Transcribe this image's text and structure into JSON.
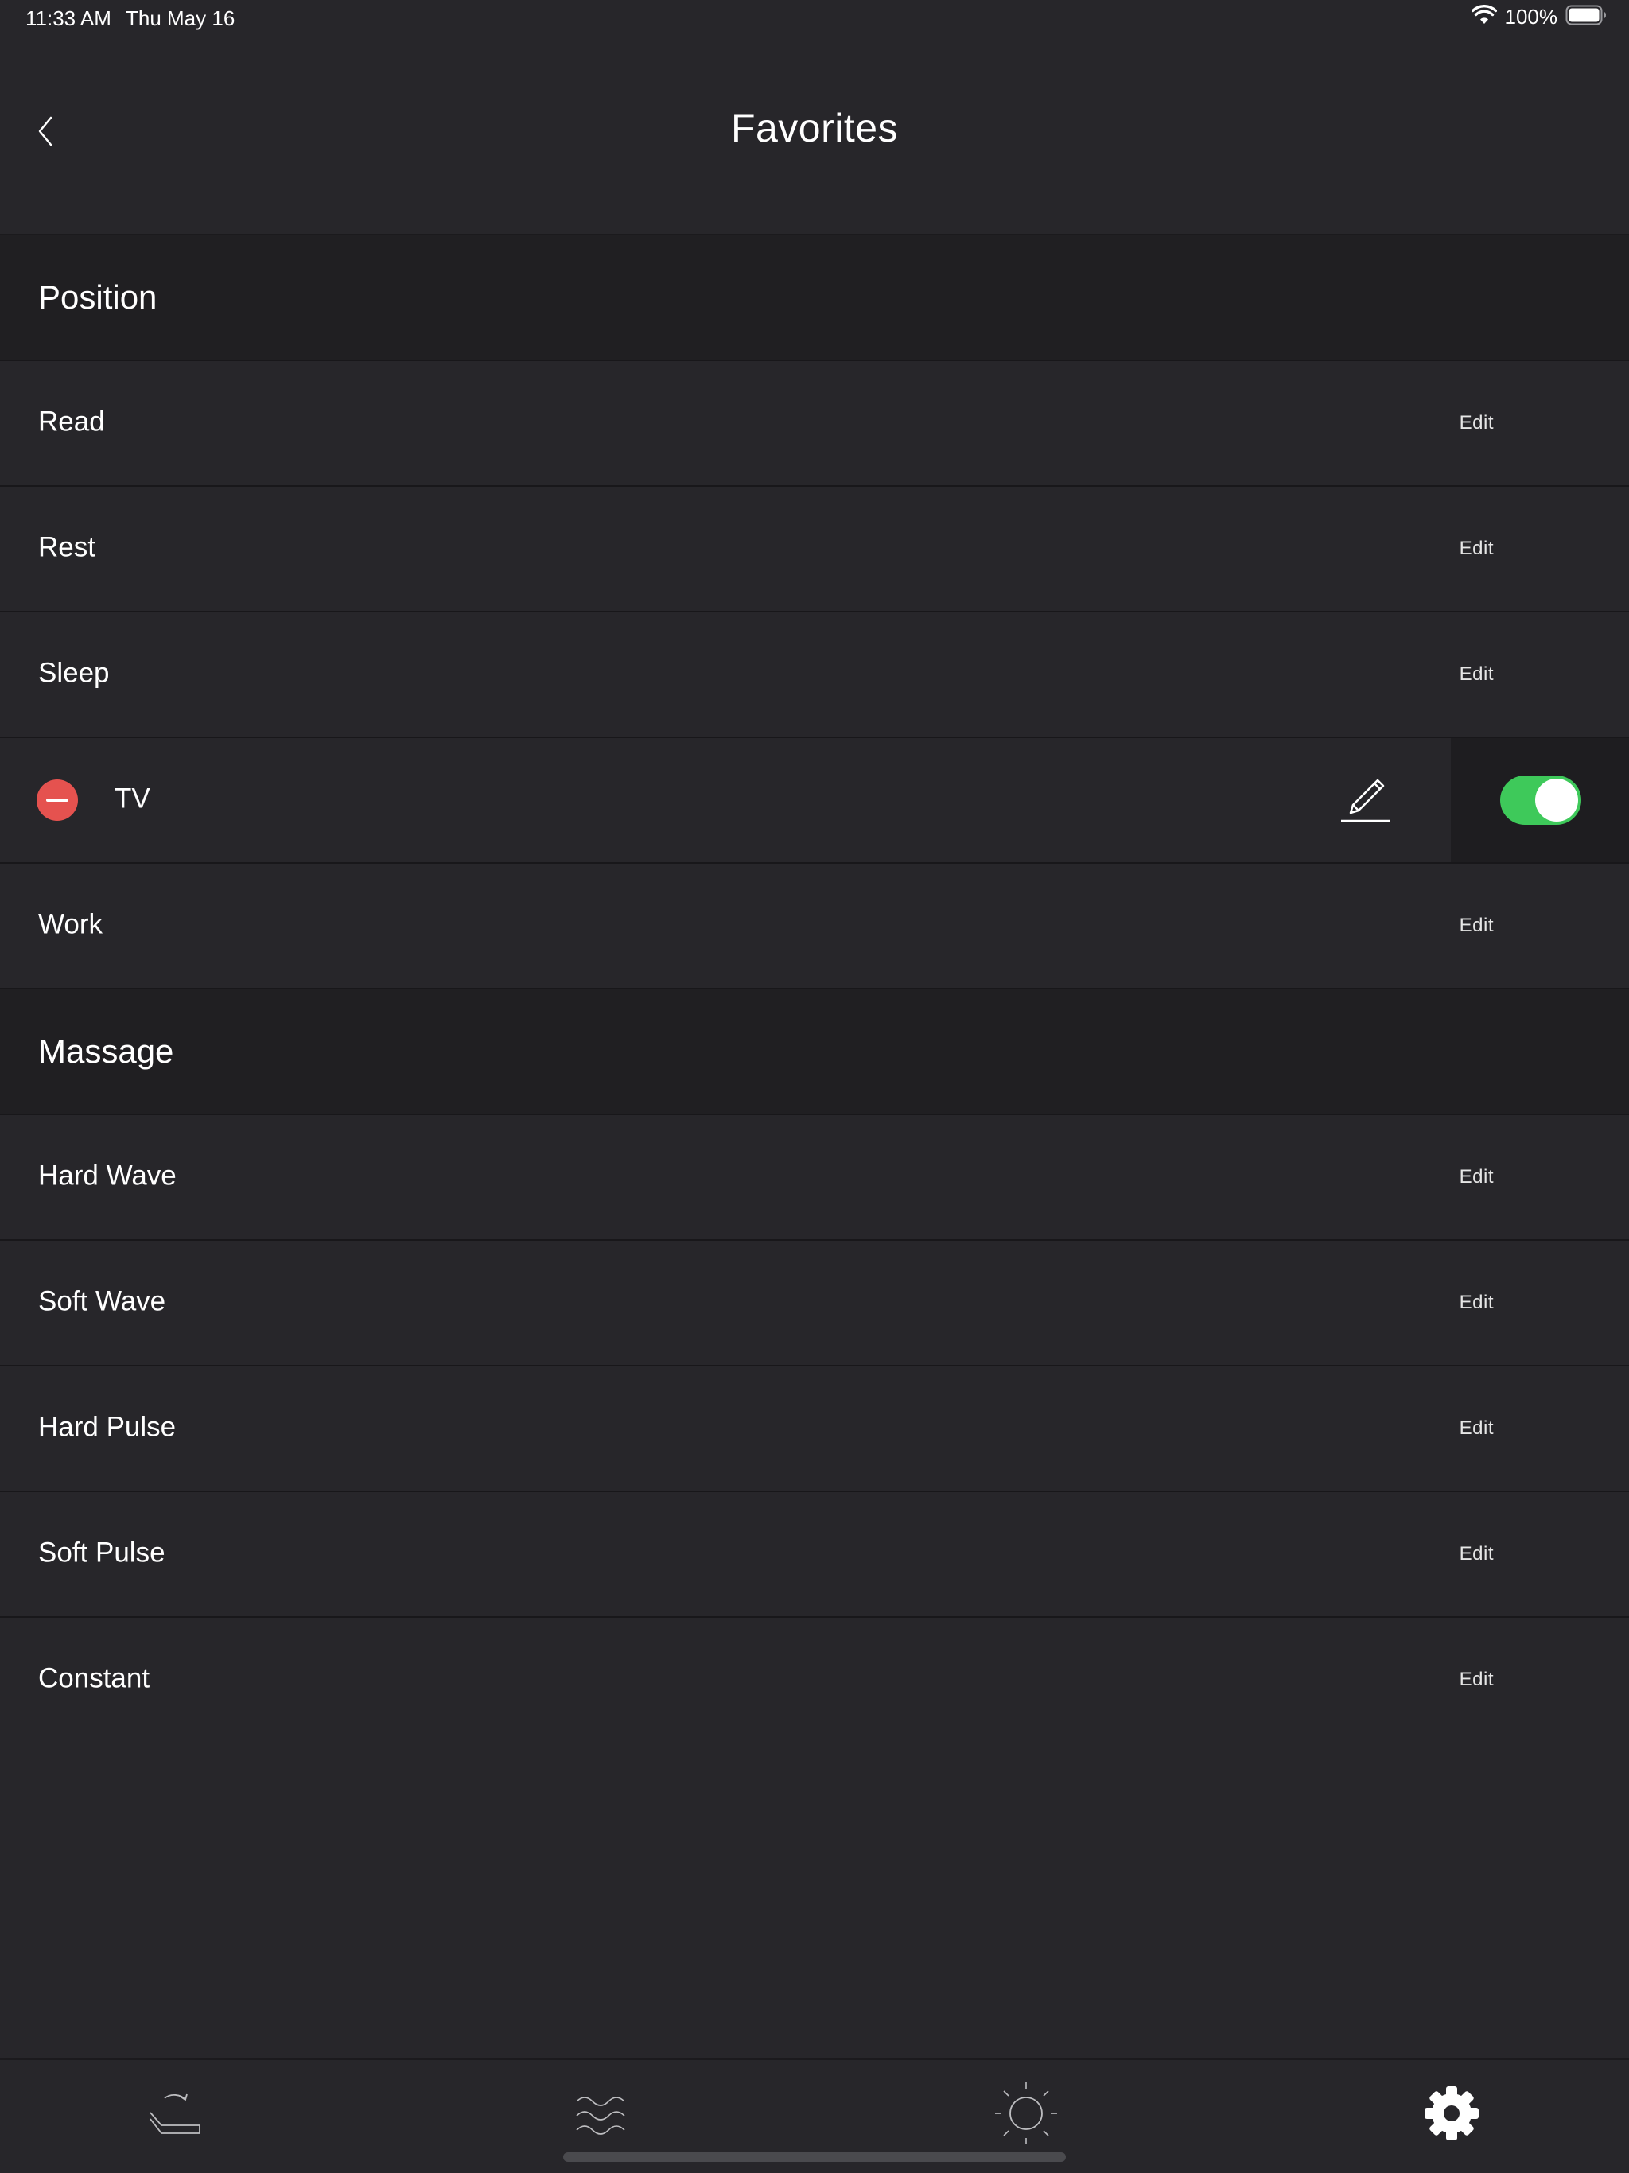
{
  "status_bar": {
    "time": "11:33 AM",
    "date": "Thu May 16",
    "battery": "100%",
    "icons": [
      "wifi-icon",
      "battery-icon"
    ]
  },
  "header": {
    "title": "Favorites",
    "back_icon": "chevron-left-icon"
  },
  "sections": {
    "position": {
      "title": "Position",
      "items": [
        {
          "label": "Read",
          "action": "Edit"
        },
        {
          "label": "Rest",
          "action": "Edit"
        },
        {
          "label": "Sleep",
          "action": "Edit"
        },
        {
          "label": "TV",
          "editing": true,
          "toggle_on": true
        },
        {
          "label": "Work",
          "action": "Edit"
        }
      ]
    },
    "massage": {
      "title": "Massage",
      "items": [
        {
          "label": "Hard Wave",
          "action": "Edit"
        },
        {
          "label": "Soft Wave",
          "action": "Edit"
        },
        {
          "label": "Hard Pulse",
          "action": "Edit"
        },
        {
          "label": "Soft Pulse",
          "action": "Edit"
        },
        {
          "label": "Constant",
          "action": "Edit"
        }
      ]
    }
  },
  "tab_bar": {
    "tabs": [
      {
        "icon": "bed-position-icon"
      },
      {
        "icon": "massage-waves-icon"
      },
      {
        "icon": "light-sun-icon"
      },
      {
        "icon": "settings-gear-icon",
        "active": true
      }
    ]
  },
  "colors": {
    "background": "#27262a",
    "section_header": "#201f22",
    "toggle_on": "#3ec95a",
    "delete": "#e5524f"
  }
}
